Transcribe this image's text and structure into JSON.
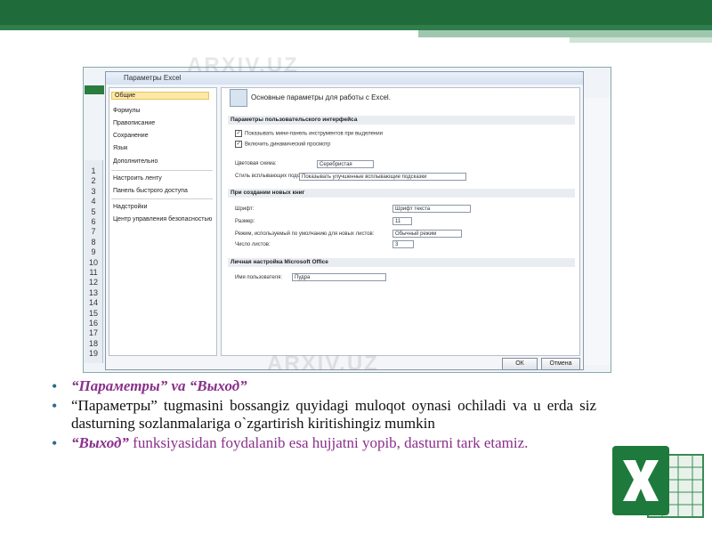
{
  "dialog": {
    "title": "Параметры Excel",
    "nav": [
      "Общие",
      "Формулы",
      "Правописание",
      "Сохранение",
      "Язык",
      "Дополнительно",
      "Настроить ленту",
      "Панель быстрого доступа",
      "Надстройки",
      "Центр управления безопасностью"
    ],
    "header": "Основные параметры для работы с Excel.",
    "sections": {
      "ui": "Параметры пользовательского интерфейса",
      "new": "При создании новых книг",
      "office": "Личная настройка Microsoft Office"
    },
    "ui_options": [
      "Показывать мини-панель инструментов при выделении",
      "Включить динамический просмотр",
      "Цветовая схема:",
      "Стиль всплывающих подсказок:"
    ],
    "ui_values": {
      "color_scheme": "Серебристая",
      "tooltips": "Показывать улучшенные всплывающие подсказки"
    },
    "new_options": [
      "Шрифт:",
      "Размер:",
      "Режим, используемый по умолчанию для новых листов:",
      "Число листов:"
    ],
    "new_values": {
      "font": "Шрифт текста",
      "size": "11",
      "mode": "Обычный режим",
      "sheets": "3"
    },
    "office_label": "Имя пользователя:",
    "office_value": "Пудра",
    "ok": "ОК",
    "cancel": "Отмена"
  },
  "row_numbers": [
    "1",
    "2",
    "3",
    "4",
    "5",
    "6",
    "7",
    "8",
    "9",
    "10",
    "11",
    "12",
    "13",
    "14",
    "15",
    "16",
    "17",
    "18",
    "19"
  ],
  "watermark": "ARXIV.UZ",
  "bullets": [
    {
      "bold": "“Параметры” va “Выход”",
      "text": ""
    },
    {
      "bold": "",
      "text": "“Параметры” tugmasini bossangiz quyidagi muloqot oynasi ochiladi va u erda siz dasturning sozlanmalariga o`zgartirish kiritishingiz mumkin"
    },
    {
      "bold": "“Выход”",
      "text": " funksiyasidan foydalanib esa hujjatni yopib, dasturni tark etamiz."
    }
  ],
  "colors": {
    "topbar": "#1f6b3a",
    "bullet": "#2e6b8a",
    "highlight": "#8a2f8a"
  }
}
